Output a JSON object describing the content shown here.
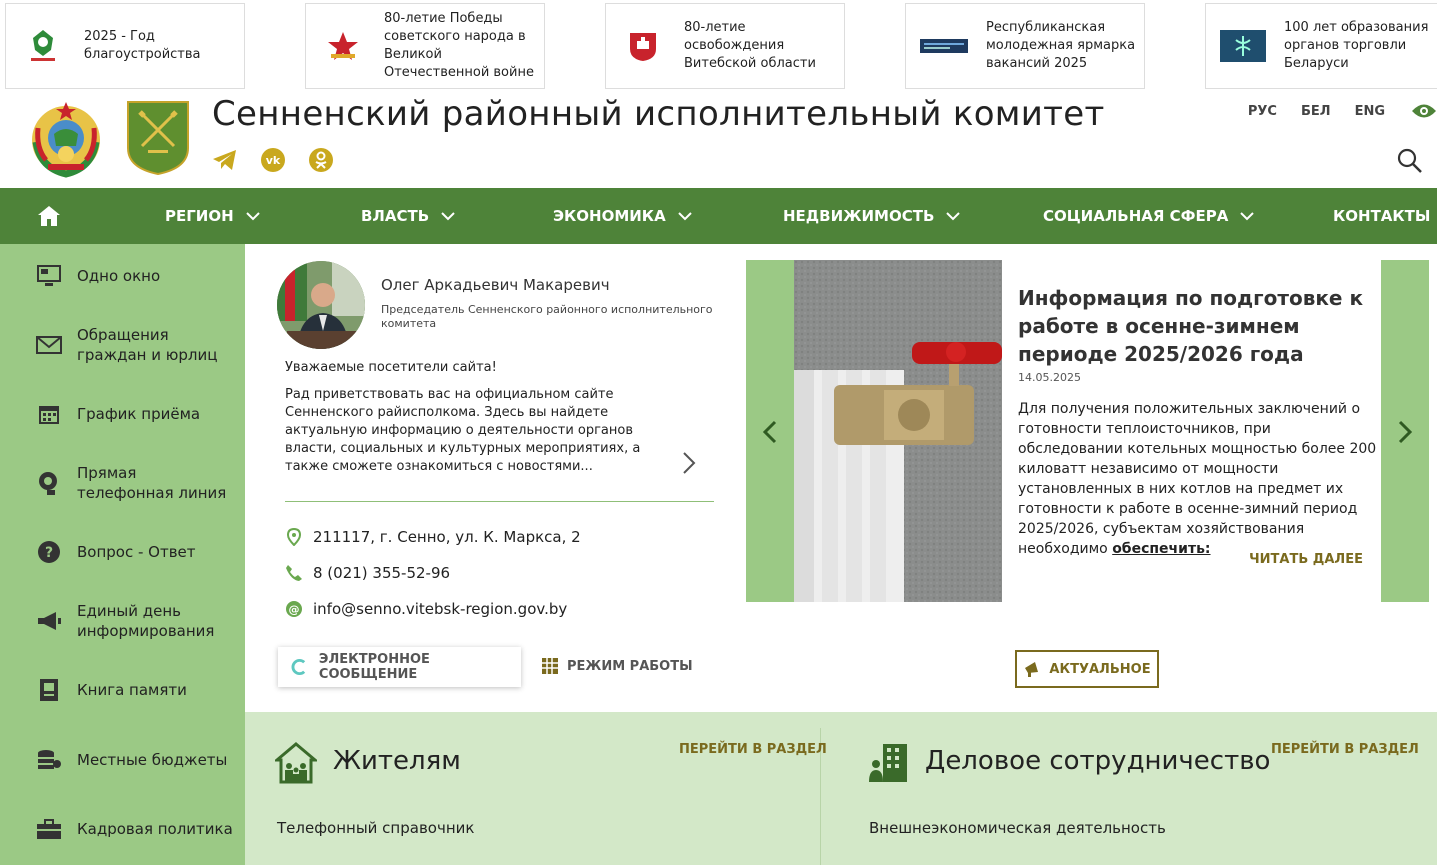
{
  "banners": [
    {
      "text": "2025 - Год благоустройства",
      "icon": "year-emblem-icon"
    },
    {
      "text": "80-летие Победы советского народа в Великой Отечественной войне",
      "icon": "victory-star-icon"
    },
    {
      "text": "80-летие освобождения Витебской области",
      "icon": "vitebsk-coat-icon"
    },
    {
      "text": "Республиканская молодежная ярмарка вакансий 2025",
      "icon": "job-fair-icon"
    },
    {
      "text": "100 лет образования органов торговли Беларуси",
      "icon": "trade-logo-icon"
    }
  ],
  "header": {
    "title": "Сенненский районный исполнительный комитет",
    "languages": [
      "РУС",
      "БЕЛ",
      "ENG"
    ]
  },
  "nav": {
    "items": [
      "РЕГИОН",
      "ВЛАСТЬ",
      "ЭКОНОМИКА",
      "НЕДВИЖИМОСТЬ",
      "СОЦИАЛЬНАЯ СФЕРА",
      "КОНТАКТЫ"
    ]
  },
  "sidebar": {
    "items": [
      {
        "label": "Одно окно",
        "icon": "monitor-icon"
      },
      {
        "label": "Обращения граждан и юрлиц",
        "icon": "envelope-icon"
      },
      {
        "label": "График приёма",
        "icon": "calendar-icon"
      },
      {
        "label": "Прямая телефонная линия",
        "icon": "headset-icon"
      },
      {
        "label": "Вопрос - Ответ",
        "icon": "question-icon"
      },
      {
        "label": "Единый день информирования",
        "icon": "megaphone-icon"
      },
      {
        "label": "Книга памяти",
        "icon": "book-icon"
      },
      {
        "label": "Местные бюджеты",
        "icon": "coins-icon"
      },
      {
        "label": "Кадровая политика",
        "icon": "briefcase-icon"
      }
    ]
  },
  "chairman": {
    "name": "Олег Аркадьевич Макаревич",
    "position": "Председатель Сенненского районного исполнительного комитета",
    "greeting": "Уважаемые посетители сайта!",
    "text": "Рад приветствовать вас на официальном сайте Сенненского райисполкома. Здесь вы найдете актуальную информацию о деятельности органов власти, социальных и культурных мероприятиях, а также сможете ознакомиться с новостями..."
  },
  "contacts": {
    "address": "211117, г. Сенно, ул. К. Маркса, 2",
    "phone": "8 (021) 355-52-96",
    "email": "info@senno.vitebsk-region.gov.by"
  },
  "buttons": {
    "message": "ЭЛЕКТРОННОЕ СООБЩЕНИЕ",
    "mode": "РЕЖИМ РАБОТЫ",
    "actual": "АКТУАЛЬНОЕ"
  },
  "slide": {
    "title": "Информация по подготовке к работе в осенне-зимнем периоде 2025/2026 года",
    "date": "14.05.2025",
    "text": "Для получения положительных заключений о готовности теплоисточников, при обследовании котельных мощностью более 200 киловатт независимо от мощности установленных в них котлов на предмет их готовности к работе в осенне-зимний период 2025/2026, субъектам хозяйствования необходимо",
    "link_word": "обеспечить:",
    "more": "ЧИТАТЬ ДАЛЕЕ"
  },
  "sections": [
    {
      "title": "Жителям",
      "link": "ПЕРЕЙТИ В РАЗДЕЛ",
      "item": "Телефонный справочник",
      "icon": "family-house-icon"
    },
    {
      "title": "Деловое сотрудничество",
      "link": "ПЕРЕЙТИ В РАЗДЕЛ",
      "item": "Внешнеэкономическая деятельность",
      "icon": "business-building-icon"
    }
  ],
  "colors": {
    "nav_green": "#4e8339",
    "sidebar_green": "#9bc985",
    "lower_green": "#d3e8c8",
    "accent_gold": "#7a6a1e",
    "social_gold": "#c9a81e"
  }
}
